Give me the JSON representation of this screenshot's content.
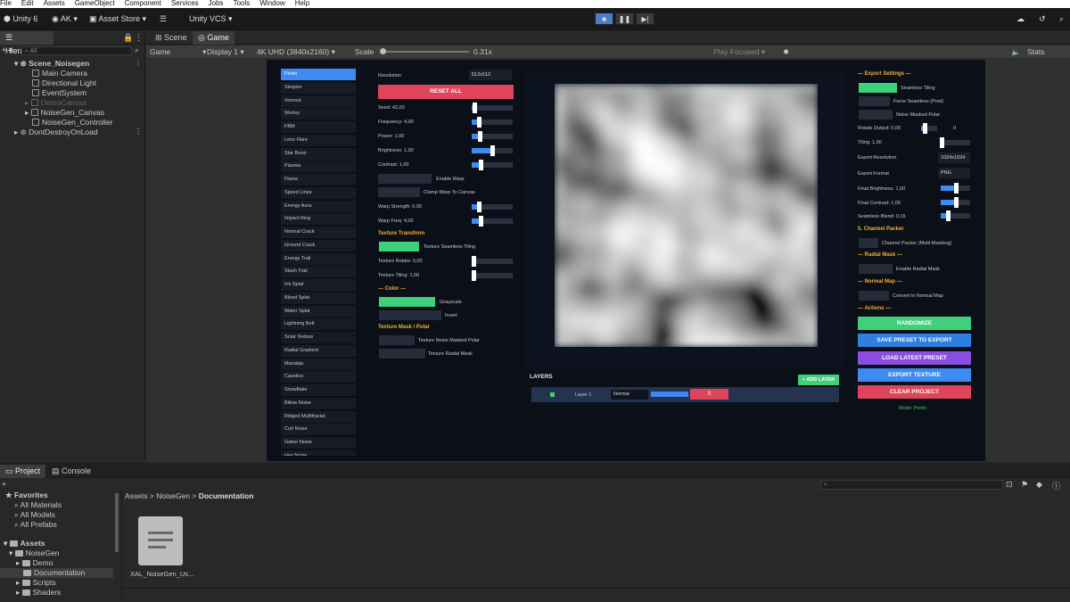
{
  "menubar": {
    "items": [
      "File",
      "Edit",
      "Assets",
      "GameObject",
      "Component",
      "Services",
      "Jobs",
      "Tools",
      "Window",
      "Help"
    ]
  },
  "toolbar": {
    "unity_version": "Unity 6",
    "account": "AK",
    "asset_store": "Asset Store",
    "vcs": "Unity VCS"
  },
  "hierarchy": {
    "title": "Hierarchy",
    "search_placeholder": "All",
    "items": [
      {
        "label": "Scene_Noisegen"
      },
      {
        "label": "Main Camera"
      },
      {
        "label": "Directional Light"
      },
      {
        "label": "EventSystem"
      },
      {
        "label": "DemoCanvas"
      },
      {
        "label": "NoiseGen_Canvas"
      },
      {
        "label": "NoiseGen_Controller"
      },
      {
        "label": "DontDestroyOnLoad"
      }
    ]
  },
  "view_tabs": {
    "scene": "Scene",
    "game": "Game"
  },
  "game_bar": {
    "mode": "Game",
    "display": "Display 1",
    "resolution": "4K UHD (3840x2160)",
    "scale_label": "Scale",
    "scale_value": "0.31x",
    "play_focused": "Play Focused",
    "stats": "Stats"
  },
  "noise_list": [
    "Perlin",
    "Simplex",
    "Voronoi",
    "Worley",
    "FBM",
    "Lens Flare",
    "Star Burst",
    "Plasma",
    "Flame",
    "Speed Lines",
    "Energy Aura",
    "Impact Ring",
    "Normal Crack",
    "Ground Crack",
    "Energy Trail",
    "Slash Trail",
    "Ink Splat",
    "Blood Splat",
    "Water Splat",
    "Lightning Bolt",
    "Solar Texture",
    "Radial Gradient",
    "Mandala",
    "Caustics",
    "Snowflake",
    "Billow Noise",
    "Ridged Multifractal",
    "Curl Noise",
    "Gabor Noise",
    "Hex Noise"
  ],
  "controls": {
    "resolution_label": "Resolution",
    "resolution_value": "512x512",
    "reset_all": "RESET ALL",
    "seed": "Seed: 42,00",
    "frequency": "Frequency: 4,00",
    "power": "Power: 1,00",
    "brightness": "Brightness: 1,00",
    "contrast": "Contrast: 1,00",
    "enable_warp": "Enable Warp",
    "clamp_warp": "Clamp Warp To Canvas",
    "warp_strength": "Warp Strength: 0,00",
    "warp_freq": "Warp Freq: 4,00",
    "texture_transform": "Texture Transform",
    "texture_seamless": "Texture Seamless Tiling",
    "texture_rotate": "Texture Rotate: 0,00",
    "texture_tiling": "Texture Tiling: 1,00",
    "color_header": "— Color —",
    "grayscale": "Grayscale",
    "invert": "Invert",
    "mask_header": "Texture Mask / Polar",
    "mask_polar": "Texture Noise Masked Polar",
    "mask_radial": "Texture Radial Mask"
  },
  "slider_levels": {
    "seed": 0.06,
    "frequency": 0.18,
    "power": 0.2,
    "brightness": 0.5,
    "contrast": 0.22,
    "warp_strength": 0.18,
    "warp_freq": 0.22,
    "texture_rotate": 0.04,
    "texture_tiling": 0.04
  },
  "layers": {
    "title": "LAYERS",
    "add_layer": "+ ADD LAYER",
    "layer_name": "Layer 1",
    "blend": "Normal",
    "delete": "X"
  },
  "export": {
    "header": "— Export Settings —",
    "seamless": "Seamless Tiling",
    "force_seamless": "Force Seamless (Post)",
    "noise_masked_polar": "Noise Masked Polar",
    "rotate_output": "Rotate Output: 0,00",
    "rotate_value": "0",
    "tiling": "Tiling: 1,00",
    "export_resolution": "Export Resolution",
    "export_resolution_value": "1024x1024",
    "export_format": "Export Format",
    "export_format_value": "PNG",
    "final_brightness": "Final Brightness: 1,00",
    "final_contrast": "Final Contrast: 1,00",
    "seamless_blend": "Seamless Blend: 0,15",
    "channel_header": "5. Channel Packer",
    "channel_packer": "Channel Packer (Multi-Masking)",
    "radial_header": "— Radial Mask —",
    "enable_radial": "Enable Radial Mask",
    "normal_header": "— Normal Map —",
    "convert_normal": "Convert to Normal Map",
    "actions_header": "— Actions —",
    "randomize": "RANDOMIZE",
    "save_preset": "SAVE PRESET TO EXPORT",
    "load_preset": "LOAD LATEST PRESET",
    "export_texture": "EXPORT TEXTURE",
    "clear_project": "CLEAR PROJECT",
    "mode": "Mode: Perlin"
  },
  "export_levels": {
    "rotate_output": 0.2,
    "tiling": 0.04,
    "final_brightness": 0.5,
    "final_contrast": 0.5,
    "seamless_blend": 0.25
  },
  "colors": {
    "accent_blue": "#3d8bf2",
    "green": "#3ed07a",
    "red": "#e0445a",
    "purple": "#8a4fe0",
    "section": "#f2b136"
  },
  "project": {
    "tab_project": "Project",
    "tab_console": "Console",
    "favorites": "Favorites",
    "fav_items": [
      "All Materials",
      "All Models",
      "All Prefabs"
    ],
    "assets": "Assets",
    "tree": [
      "NoiseGen",
      "Demo",
      "Documentation",
      "Scripts",
      "Shaders"
    ],
    "breadcrumb": [
      "Assets",
      "NoiseGen",
      "Documentation"
    ],
    "file_name": "XAL_NoiseGen_Us..."
  }
}
